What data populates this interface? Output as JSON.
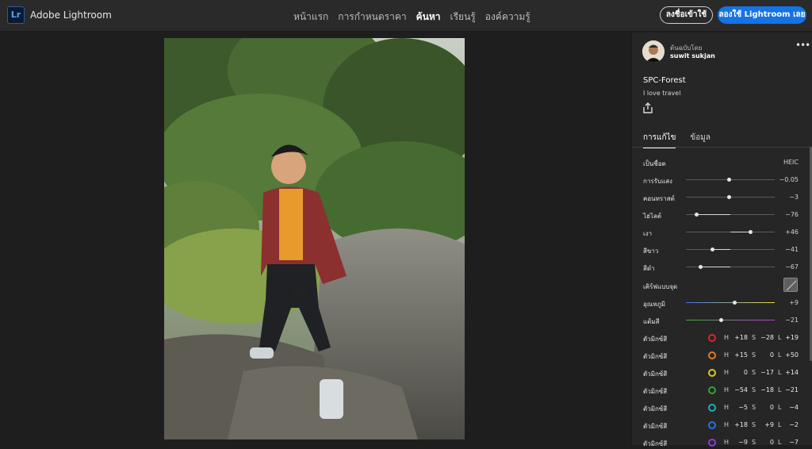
{
  "app": {
    "logo": "Lr",
    "name": "Adobe Lightroom"
  },
  "nav": {
    "items": [
      "หน้าแรก",
      "การกำหนดราคา",
      "ค้นหา",
      "เรียนรู้",
      "องค์ความรู้"
    ],
    "active_index": 2
  },
  "header": {
    "signin_label": "ลงชื่อเข้าใช้",
    "try_label": "ลองใช้ Lightroom เลย",
    "try_color": "#1473e6"
  },
  "photo": {
    "description_icon": "portrait-photo-icon"
  },
  "panel": {
    "by_label": "ต้นฉบับโดย",
    "author": "suwit sukjan",
    "more_label": "•••",
    "preset_title": "SPC-Forest",
    "preset_desc": "I love travel",
    "tabs": [
      "การแก้ไข",
      "ข้อมูล"
    ],
    "active_tab": 0,
    "base_label": "เป็นชื่อต",
    "base_value": "HEIC",
    "sliders": [
      {
        "label": "การรับแสง",
        "value": "−0.05",
        "level": -0.02
      },
      {
        "label": "คอนทราสต์",
        "value": "−3",
        "level": -0.03
      },
      {
        "label": "ไฮไลต์",
        "value": "−76",
        "level": -0.76
      },
      {
        "label": "เงา",
        "value": "+46",
        "level": 0.46
      },
      {
        "label": "สีขาว",
        "value": "−41",
        "level": -0.41
      },
      {
        "label": "สีดำ",
        "value": "−67",
        "level": -0.67
      }
    ],
    "curve_label": "เคิร์ฟแบบจุด",
    "temp": {
      "label": "อุณหภูมิ",
      "value": "+9",
      "level": 0.09
    },
    "tint": {
      "label": "แต้มสี",
      "value": "−21",
      "level": -0.21
    },
    "mixer_label": "ตัวมิกซ์สี",
    "mixers": [
      {
        "color": "#d42a2a",
        "h": "+18",
        "s": "−28",
        "l": "+19"
      },
      {
        "color": "#e07a1f",
        "h": "+15",
        "s": "0",
        "l": "+50"
      },
      {
        "color": "#d6c91a",
        "h": "0",
        "s": "−17",
        "l": "+14"
      },
      {
        "color": "#2ea52e",
        "h": "−54",
        "s": "−18",
        "l": "−21"
      },
      {
        "color": "#1eb0b0",
        "h": "−5",
        "s": "0",
        "l": "−4"
      },
      {
        "color": "#2b6fe0",
        "h": "+18",
        "s": "+9",
        "l": "−2"
      },
      {
        "color": "#8a3ad8",
        "h": "−9",
        "s": "0",
        "l": "−7"
      }
    ]
  }
}
